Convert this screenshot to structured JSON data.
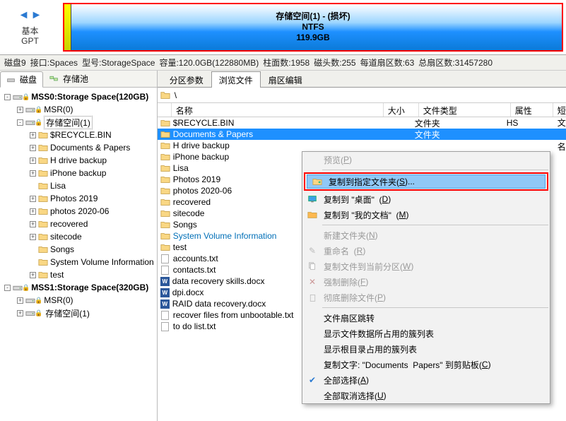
{
  "top": {
    "nav_back": "◄",
    "nav_fwd": "►",
    "label1": "基本",
    "label2": "GPT",
    "vol_title": "存储空间(1) - (损坏)",
    "vol_fs": "NTFS",
    "vol_size": "119.9GB"
  },
  "infoline": [
    "磁盘9",
    "接口:Spaces",
    "型号:StorageSpace",
    "容量:120.0GB(122880MB)",
    "柱面数:1958",
    "磁头数:255",
    "每道扇区数:63",
    "总扇区数:31457280"
  ],
  "west_tabs": {
    "a": "磁盘",
    "b": "存储池"
  },
  "tree": [
    {
      "d": 0,
      "e": "-",
      "t": "disk",
      "lbl": "MSS0:Storage Space(120GB)"
    },
    {
      "d": 1,
      "e": "+",
      "t": "vol",
      "lbl": "MSR(0)"
    },
    {
      "d": 1,
      "e": "-",
      "t": "vol",
      "lbl": "存储空间(1)",
      "hl": true,
      "sel": true
    },
    {
      "d": 2,
      "e": "+",
      "t": "fld",
      "lbl": "$RECYCLE.BIN"
    },
    {
      "d": 2,
      "e": "+",
      "t": "fld",
      "lbl": "Documents & Papers"
    },
    {
      "d": 2,
      "e": "+",
      "t": "fld",
      "lbl": "H drive backup"
    },
    {
      "d": 2,
      "e": "+",
      "t": "fld",
      "lbl": "iPhone backup"
    },
    {
      "d": 2,
      "e": " ",
      "t": "fld",
      "lbl": "Lisa"
    },
    {
      "d": 2,
      "e": "+",
      "t": "fld",
      "lbl": "Photos 2019"
    },
    {
      "d": 2,
      "e": "+",
      "t": "fld",
      "lbl": "photos 2020-06"
    },
    {
      "d": 2,
      "e": "+",
      "t": "fld",
      "lbl": "recovered"
    },
    {
      "d": 2,
      "e": "+",
      "t": "fld",
      "lbl": "sitecode"
    },
    {
      "d": 2,
      "e": " ",
      "t": "fld",
      "lbl": "Songs"
    },
    {
      "d": 2,
      "e": " ",
      "t": "fld",
      "lbl": "System Volume Information"
    },
    {
      "d": 2,
      "e": "+",
      "t": "fld",
      "lbl": "test"
    },
    {
      "d": 0,
      "e": "-",
      "t": "disk",
      "lbl": "MSS1:Storage Space(320GB)"
    },
    {
      "d": 1,
      "e": "+",
      "t": "vol",
      "lbl": "MSR(0)"
    },
    {
      "d": 1,
      "e": "+",
      "t": "vol",
      "lbl": "存储空间(1)",
      "hl": true
    }
  ],
  "east_tabs": [
    "分区参数",
    "浏览文件",
    "扇区编辑"
  ],
  "east_active": 1,
  "path": "\\",
  "columns": [
    "名称",
    "大小",
    "文件类型",
    "属性",
    "短文件名"
  ],
  "files": [
    {
      "ic": "fld",
      "name": "$RECYCLE.BIN",
      "type": "文件夹",
      "attr": "HS"
    },
    {
      "ic": "fld",
      "name": "Documents & Papers",
      "type": "文件夹",
      "sel": true
    },
    {
      "ic": "fld",
      "name": "H drive backup"
    },
    {
      "ic": "fld",
      "name": "iPhone backup"
    },
    {
      "ic": "fld",
      "name": "Lisa"
    },
    {
      "ic": "fld",
      "name": "Photos 2019"
    },
    {
      "ic": "fld",
      "name": "photos 2020-06"
    },
    {
      "ic": "fld",
      "name": "recovered"
    },
    {
      "ic": "fld",
      "name": "sitecode"
    },
    {
      "ic": "fld",
      "name": "Songs"
    },
    {
      "ic": "fld",
      "name": "System Volume Information",
      "sys": true
    },
    {
      "ic": "fld",
      "name": "test"
    },
    {
      "ic": "doc",
      "name": "accounts.txt"
    },
    {
      "ic": "doc",
      "name": "contacts.txt"
    },
    {
      "ic": "word",
      "name": "data recovery skills.docx"
    },
    {
      "ic": "word",
      "name": "dpi.docx"
    },
    {
      "ic": "word",
      "name": "RAID data recovery.docx"
    },
    {
      "ic": "doc",
      "name": "recover files from unbootable.txt"
    },
    {
      "ic": "doc",
      "name": "to do list.txt"
    }
  ],
  "menu": {
    "preview": "预览(P)",
    "copy_to": "复制到指定文件夹(S)...",
    "copy_desktop": "复制到 \"桌面\"  (D)",
    "copy_docs": "复制到 \"我的文档\"  (M)",
    "newfolder": "新建文件夹(N)",
    "rename": "重命名  (R)",
    "copy_cur": "复制文件到当前分区(W)",
    "force_del": "强制删除(F)",
    "purge": "彻底删除文件(P)",
    "jump": "文件扇区跳转",
    "show_clust": "显示文件数据所占用的簇列表",
    "show_root": "显示根目录占用的簇列表",
    "copy_text": "复制文字: \"Documents  Papers\" 到剪贴板(C)",
    "sel_all": "全部选择(A)",
    "sel_none": "全部取消选择(U)"
  }
}
